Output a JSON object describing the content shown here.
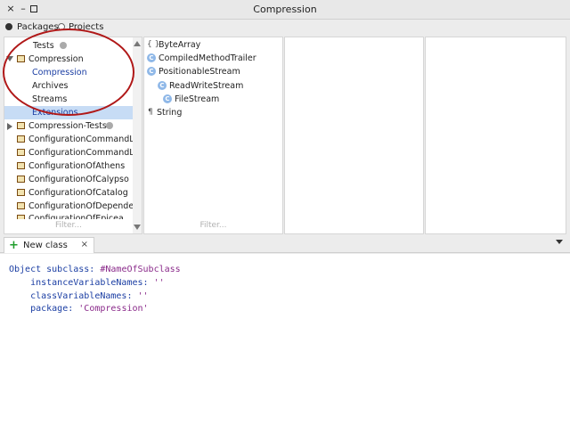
{
  "window": {
    "title": "Compression"
  },
  "radio": {
    "packages_label": "Packages",
    "projects_label": "Projects"
  },
  "packages_pane": {
    "items": [
      {
        "label": "Tests"
      },
      {
        "label": "Compression"
      },
      {
        "label": "Compression"
      },
      {
        "label": "Archives"
      },
      {
        "label": "Streams"
      },
      {
        "label": "Extensions"
      },
      {
        "label": "Compression-Tests"
      },
      {
        "label": "ConfigurationCommandLineH"
      },
      {
        "label": "ConfigurationCommandLineH"
      },
      {
        "label": "ConfigurationOfAthens"
      },
      {
        "label": "ConfigurationOfCalypso"
      },
      {
        "label": "ConfigurationOfCatalog"
      },
      {
        "label": "ConfigurationOfDependencyA"
      },
      {
        "label": "ConfigurationOfEpicea"
      }
    ],
    "filter_placeholder": "Filter..."
  },
  "classes_pane": {
    "items": [
      {
        "label": "ByteArray",
        "icon": "braces-icon"
      },
      {
        "label": "CompiledMethodTrailer",
        "icon": "class-icon"
      },
      {
        "label": "PositionableStream",
        "icon": "class-icon"
      },
      {
        "label": "ReadWriteStream",
        "icon": "class-icon"
      },
      {
        "label": "FileStream",
        "icon": "class-icon"
      },
      {
        "label": "String",
        "icon": "pilcrow-icon"
      }
    ],
    "filter_placeholder": "Filter..."
  },
  "tab": {
    "label": "New class",
    "close": "×"
  },
  "editor": {
    "line1_a": "Object subclass: ",
    "line1_b": "#NameOfSubclass",
    "line2_a": "    instanceVariableNames: ",
    "line2_b": "''",
    "line3_a": "    classVariableNames: ",
    "line3_b": "''",
    "line4_a": "    package: ",
    "line4_b": "'Compression'"
  },
  "colors": {
    "selection": "#c7dcf5",
    "annotation_circle": "#b01818",
    "code_blue": "#1b3ea3",
    "code_purple": "#8a2a8a"
  }
}
